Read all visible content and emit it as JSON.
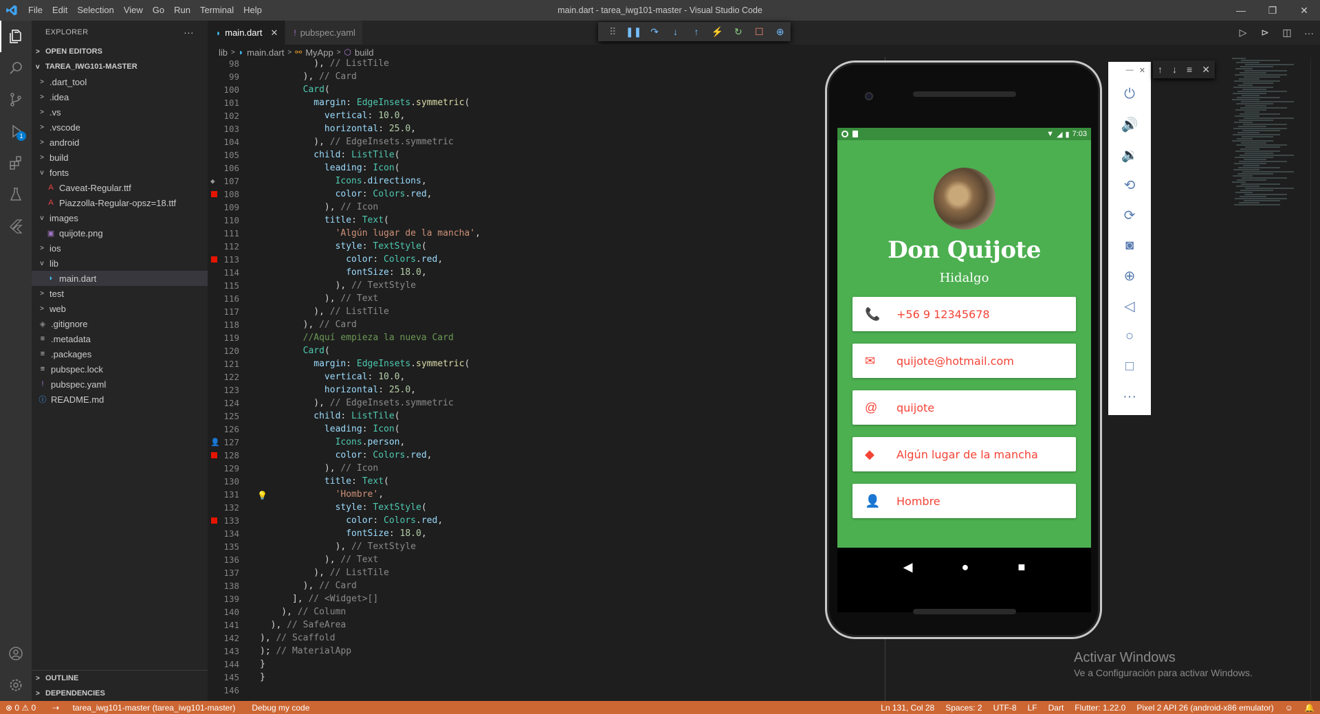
{
  "window": {
    "title": "main.dart - tarea_iwg101-master - Visual Studio Code",
    "menu": [
      "File",
      "Edit",
      "Selection",
      "View",
      "Go",
      "Run",
      "Terminal",
      "Help"
    ]
  },
  "activity_badge": "1",
  "explorer": {
    "title": "EXPLORER",
    "open_editors": "OPEN EDITORS",
    "root": "TAREA_IWG101-MASTER",
    "items": [
      {
        "label": ".dart_tool",
        "depth": 1,
        "kind": "folder",
        "icon": "chevron-right-icon"
      },
      {
        "label": ".idea",
        "depth": 1,
        "kind": "folder",
        "icon": "chevron-right-icon"
      },
      {
        "label": ".vs",
        "depth": 1,
        "kind": "folder",
        "icon": "chevron-right-icon"
      },
      {
        "label": ".vscode",
        "depth": 1,
        "kind": "folder",
        "icon": "chevron-right-icon"
      },
      {
        "label": "android",
        "depth": 1,
        "kind": "folder",
        "icon": "chevron-right-icon"
      },
      {
        "label": "build",
        "depth": 1,
        "kind": "folder",
        "icon": "chevron-right-icon"
      },
      {
        "label": "fonts",
        "depth": 1,
        "kind": "folder-open",
        "icon": "chevron-down-icon"
      },
      {
        "label": "Caveat-Regular.ttf",
        "depth": 2,
        "kind": "font",
        "icon": "font-file-icon"
      },
      {
        "label": "Piazzolla-Regular-opsz=18.ttf",
        "depth": 2,
        "kind": "font",
        "icon": "font-file-icon"
      },
      {
        "label": "images",
        "depth": 1,
        "kind": "folder-open",
        "icon": "chevron-down-icon"
      },
      {
        "label": "quijote.png",
        "depth": 2,
        "kind": "image",
        "icon": "image-file-icon"
      },
      {
        "label": "ios",
        "depth": 1,
        "kind": "folder",
        "icon": "chevron-right-icon"
      },
      {
        "label": "lib",
        "depth": 1,
        "kind": "folder-open",
        "icon": "chevron-down-icon"
      },
      {
        "label": "main.dart",
        "depth": 2,
        "kind": "dart",
        "icon": "dart-file-icon",
        "selected": true
      },
      {
        "label": "test",
        "depth": 1,
        "kind": "folder",
        "icon": "chevron-right-icon"
      },
      {
        "label": "web",
        "depth": 1,
        "kind": "folder",
        "icon": "chevron-right-icon"
      },
      {
        "label": ".gitignore",
        "depth": 1,
        "kind": "git",
        "icon": "git-file-icon"
      },
      {
        "label": ".metadata",
        "depth": 1,
        "kind": "text",
        "icon": "text-file-icon"
      },
      {
        "label": ".packages",
        "depth": 1,
        "kind": "text",
        "icon": "text-file-icon"
      },
      {
        "label": "pubspec.lock",
        "depth": 1,
        "kind": "text",
        "icon": "text-file-icon"
      },
      {
        "label": "pubspec.yaml",
        "depth": 1,
        "kind": "yaml",
        "icon": "yaml-file-icon"
      },
      {
        "label": "README.md",
        "depth": 1,
        "kind": "info",
        "icon": "info-file-icon"
      }
    ],
    "outline": "OUTLINE",
    "dependencies": "DEPENDENCIES"
  },
  "tabs": [
    {
      "label": "main.dart",
      "active": true
    },
    {
      "label": "pubspec.yaml",
      "active": false
    }
  ],
  "breadcrumbs": [
    "lib",
    "main.dart",
    "MyApp",
    "build"
  ],
  "code_lines": [
    {
      "n": "98",
      "html": "<span>          ), </span><span class=\"cg\">// ListTile</span>"
    },
    {
      "n": "99",
      "html": "<span>        ), </span><span class=\"cg\">// Card</span>"
    },
    {
      "n": "100",
      "html": "<span>        </span><span class=\"t\">Card</span><span>(</span>"
    },
    {
      "n": "101",
      "html": "<span>          </span><span class=\"p\">margin</span><span>: </span><span class=\"t\">EdgeInsets</span><span>.</span><span class=\"f\">symmetric</span><span>(</span>"
    },
    {
      "n": "102",
      "html": "<span>            </span><span class=\"p\">vertical</span><span>: </span><span class=\"n\">10.0</span><span>,</span>"
    },
    {
      "n": "103",
      "html": "<span>            </span><span class=\"p\">horizontal</span><span>: </span><span class=\"n\">25.0</span><span>,</span>"
    },
    {
      "n": "104",
      "html": "<span>          ), </span><span class=\"cg\">// EdgeInsets.symmetric</span>"
    },
    {
      "n": "105",
      "html": "<span>          </span><span class=\"p\">child</span><span>: </span><span class=\"t\">ListTile</span><span>(</span>"
    },
    {
      "n": "106",
      "html": "<span>            </span><span class=\"p\">leading</span><span>: </span><span class=\"t\">Icon</span><span>(</span>"
    },
    {
      "n": "107",
      "gi": "◆",
      "html": "<span>              </span><span class=\"t\">Icons</span><span>.</span><span class=\"p\">directions</span><span>,</span>"
    },
    {
      "n": "108",
      "bp": true,
      "html": "<span>              </span><span class=\"p\">color</span><span>: </span><span class=\"t\">Colors</span><span>.</span><span class=\"p\">red</span><span>,</span>"
    },
    {
      "n": "109",
      "html": "<span>            ), </span><span class=\"cg\">// Icon</span>"
    },
    {
      "n": "110",
      "html": "<span>            </span><span class=\"p\">title</span><span>: </span><span class=\"t\">Text</span><span>(</span>"
    },
    {
      "n": "111",
      "html": "<span>              </span><span class=\"s\">'Algún lugar de la mancha'</span><span>,</span>"
    },
    {
      "n": "112",
      "html": "<span>              </span><span class=\"p\">style</span><span>: </span><span class=\"t\">TextStyle</span><span>(</span>"
    },
    {
      "n": "113",
      "bp": true,
      "html": "<span>                </span><span class=\"p\">color</span><span>: </span><span class=\"t\">Colors</span><span>.</span><span class=\"p\">red</span><span>,</span>"
    },
    {
      "n": "114",
      "html": "<span>                </span><span class=\"p\">fontSize</span><span>: </span><span class=\"n\">18.0</span><span>,</span>"
    },
    {
      "n": "115",
      "html": "<span>              ), </span><span class=\"cg\">// TextStyle</span>"
    },
    {
      "n": "116",
      "html": "<span>            ), </span><span class=\"cg\">// Text</span>"
    },
    {
      "n": "117",
      "html": "<span>          ), </span><span class=\"cg\">// ListTile</span>"
    },
    {
      "n": "118",
      "html": "<span>        ), </span><span class=\"cg\">// Card</span>"
    },
    {
      "n": "119",
      "html": "<span>        </span><span class=\"c\">//Aquí empieza la nueva Card</span>"
    },
    {
      "n": "120",
      "html": "<span>        </span><span class=\"t\">Card</span><span>(</span>"
    },
    {
      "n": "121",
      "html": "<span>          </span><span class=\"p\">margin</span><span>: </span><span class=\"t\">EdgeInsets</span><span>.</span><span class=\"f\">symmetric</span><span>(</span>"
    },
    {
      "n": "122",
      "html": "<span>            </span><span class=\"p\">vertical</span><span>: </span><span class=\"n\">10.0</span><span>,</span>"
    },
    {
      "n": "123",
      "html": "<span>            </span><span class=\"p\">horizontal</span><span>: </span><span class=\"n\">25.0</span><span>,</span>"
    },
    {
      "n": "124",
      "html": "<span>          ), </span><span class=\"cg\">// EdgeInsets.symmetric</span>"
    },
    {
      "n": "125",
      "html": "<span>          </span><span class=\"p\">child</span><span>: </span><span class=\"t\">ListTile</span><span>(</span>"
    },
    {
      "n": "126",
      "html": "<span>            </span><span class=\"p\">leading</span><span>: </span><span class=\"t\">Icon</span><span>(</span>"
    },
    {
      "n": "127",
      "gi": "👤",
      "html": "<span>              </span><span class=\"t\">Icons</span><span>.</span><span class=\"p\">person</span><span>,</span>"
    },
    {
      "n": "128",
      "bp": true,
      "html": "<span>              </span><span class=\"p\">color</span><span>: </span><span class=\"t\">Colors</span><span>.</span><span class=\"p\">red</span><span>,</span>"
    },
    {
      "n": "129",
      "html": "<span>            ), </span><span class=\"cg\">// Icon</span>"
    },
    {
      "n": "130",
      "html": "<span>            </span><span class=\"p\">title</span><span>: </span><span class=\"t\">Text</span><span>(</span>"
    },
    {
      "n": "131",
      "bulb": true,
      "html": "<span>              </span><span class=\"s\">'Hombre'</span><span>,</span>"
    },
    {
      "n": "132",
      "html": "<span>              </span><span class=\"p\">style</span><span>: </span><span class=\"t\">TextStyle</span><span>(</span>"
    },
    {
      "n": "133",
      "bp": true,
      "html": "<span>                </span><span class=\"p\">color</span><span>: </span><span class=\"t\">Colors</span><span>.</span><span class=\"p\">red</span><span>,</span>"
    },
    {
      "n": "134",
      "html": "<span>                </span><span class=\"p\">fontSize</span><span>: </span><span class=\"n\">18.0</span><span>,</span>"
    },
    {
      "n": "135",
      "html": "<span>              ), </span><span class=\"cg\">// TextStyle</span>"
    },
    {
      "n": "136",
      "html": "<span>            ), </span><span class=\"cg\">// Text</span>"
    },
    {
      "n": "137",
      "html": "<span>          ), </span><span class=\"cg\">// ListTile</span>"
    },
    {
      "n": "138",
      "html": "<span>        ), </span><span class=\"cg\">// Card</span>"
    },
    {
      "n": "139",
      "html": "<span>      ], </span><span class=\"cg\">// &lt;Widget&gt;[]</span>"
    },
    {
      "n": "140",
      "html": "<span>    ), </span><span class=\"cg\">// Column</span>"
    },
    {
      "n": "141",
      "html": "<span>  ), </span><span class=\"cg\">// SafeArea</span>"
    },
    {
      "n": "142",
      "html": "<span>), </span><span class=\"cg\">// Scaffold</span>"
    },
    {
      "n": "143",
      "html": "<span>); </span><span class=\"cg\">// MaterialApp</span>"
    },
    {
      "n": "144",
      "html": "<span>}</span>"
    },
    {
      "n": "145",
      "html": "<span>}</span>"
    },
    {
      "n": "146",
      "html": ""
    }
  ],
  "phone": {
    "status_time": "7:03",
    "app_title": "Don Quijote",
    "app_subtitle": "Hidalgo",
    "cards": [
      {
        "icon": "phone-icon",
        "glyph": "📞",
        "text": "+56 9 12345678"
      },
      {
        "icon": "email-icon",
        "glyph": "✉",
        "text": "quijote@hotmail.com"
      },
      {
        "icon": "at-icon",
        "glyph": "@",
        "text": "quijote"
      },
      {
        "icon": "directions-icon",
        "glyph": "◆",
        "text": "Algún lugar de la mancha"
      },
      {
        "icon": "person-icon",
        "glyph": "👤",
        "text": "Hombre"
      }
    ]
  },
  "watermark": {
    "line1": "Activar Windows",
    "line2": "Ve a Configuración para activar Windows."
  },
  "statusbar": {
    "errors": "⊗ 0 ⚠ 0",
    "branch": "tarea_iwg101-master (tarea_iwg101-master)",
    "debug": "Debug my code",
    "position": "Ln 131, Col 28",
    "spaces": "Spaces: 2",
    "encoding": "UTF-8",
    "eol": "LF",
    "language": "Dart",
    "flutter": "Flutter: 1.22.0",
    "device": "Pixel 2 API 26 (android-x86 emulator)"
  }
}
